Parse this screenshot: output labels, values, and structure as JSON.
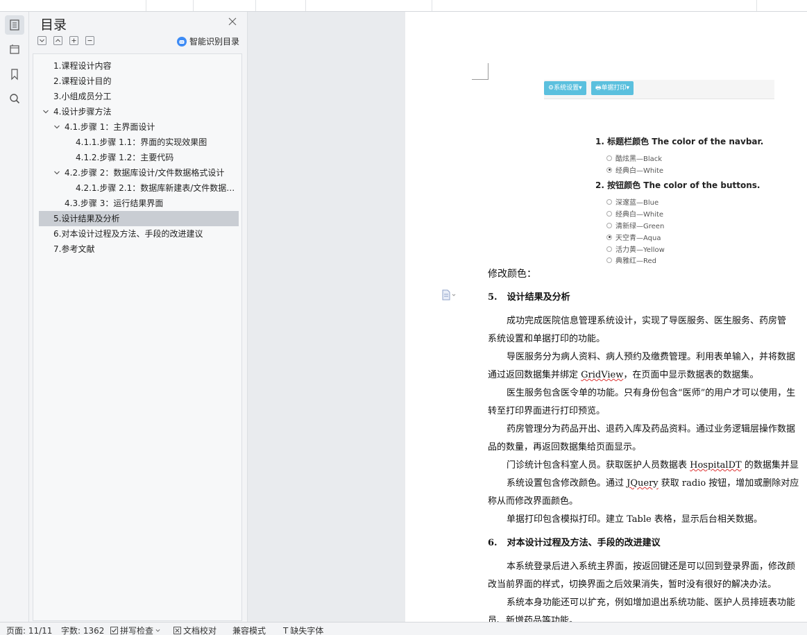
{
  "toc": {
    "title": "目录",
    "smart_label": "智能识别目录",
    "items": [
      {
        "label": "1.课程设计内容",
        "level": 0
      },
      {
        "label": "2.课程设计目的",
        "level": 0
      },
      {
        "label": "3.小组成员分工",
        "level": 0
      },
      {
        "label": "4.设计步骤方法",
        "level": 0,
        "expanded": true
      },
      {
        "label": "4.1.步骤 1：主界面设计",
        "level": 1,
        "expanded": true
      },
      {
        "label": "4.1.1.步骤 1.1：界面的实现效果图",
        "level": 2
      },
      {
        "label": "4.1.2.步骤 1.2：主要代码",
        "level": 2
      },
      {
        "label": "4.2.步骤 2：数据库设计/文件数据格式设计",
        "level": 1,
        "expanded": true
      },
      {
        "label": "4.2.1.步骤 2.1：数据库新建表/文件数据格式",
        "level": 2
      },
      {
        "label": "4.3.步骤 3：运行结果界面",
        "level": 1
      },
      {
        "label": "5.设计结果及分析",
        "level": 0,
        "selected": true
      },
      {
        "label": "6.对本设计过程及方法、手段的改进建议",
        "level": 0
      },
      {
        "label": "7.参考文献",
        "level": 0
      }
    ]
  },
  "document": {
    "embed": {
      "btn_settings": "⚙系统设置▾",
      "btn_print": "🖶单据打印▾",
      "section1": "1. 标题栏颜色 The color of the navbar.",
      "options1": [
        {
          "label": "酷炫黑—Black",
          "checked": false
        },
        {
          "label": "经典白—White",
          "checked": true
        }
      ],
      "section2": "2. 按钮颜色 The color of the buttons.",
      "options2": [
        {
          "label": "深邃蓝—Blue",
          "checked": false
        },
        {
          "label": "经典白—White",
          "checked": false
        },
        {
          "label": "清新绿—Green",
          "checked": false
        },
        {
          "label": "天空青—Aqua",
          "checked": true
        },
        {
          "label": "活力黄—Yellow",
          "checked": false
        },
        {
          "label": "典雅红—Red",
          "checked": false
        }
      ]
    },
    "caption": "修改颜色：",
    "heading5_num": "5.",
    "heading5": "设计结果及分析",
    "p1a": "成功完成医院信息管理系统设计，实现了导医服务、医生服务、药房管",
    "p1b": "系统设置和单据打印的功能。",
    "p2a": "导医服务分为病人资料、病人预约及缴费管理。利用表单输入，并将数据",
    "p2b_pre": "通过返回数据集并绑定 ",
    "p2b_mark": "GridView",
    "p2b_post": "，在页面中显示数据表的数据集。",
    "p3a": "医生服务包含医令单的功能。只有身份包含“医师”的用户才可以使用，生",
    "p3b": "转至打印界面进行打印预览。",
    "p4a": "药房管理分为药品开出、退药入库及药品资料。通过业务逻辑层操作数据",
    "p4b": "品的数量，再返回数据集给页面显示。",
    "p5_pre": "门诊统计包含科室人员。获取医护人员数据表 ",
    "p5_mark": "HospitalDT",
    "p5_post": " 的数据集并显",
    "p6_pre": "系统设置包含修改颜色。通过 ",
    "p6_mark": "JQuery",
    "p6_post": " 获取 radio 按钮，增加或删除对应",
    "p6b": "称从而修改界面颜色。",
    "p7": "单据打印包含模拟打印。建立 Table 表格，显示后台相关数据。",
    "heading6_num": "6.",
    "heading6": "对本设计过程及方法、手段的改进建议",
    "p8a": "本系统登录后进入系统主界面，按返回键还是可以回到登录界面，修改颜",
    "p8b": "改当前界面的样式，切换界面之后效果消失，暂时没有很好的解决办法。",
    "p9a": "系统本身功能还可以扩充，例如增加退出系统功能、医护人员排班表功能",
    "p9b": "员、新增药品等功能。"
  },
  "status": {
    "page": "页面: 11/11",
    "words": "字数: 1362",
    "spell": "拼写检查",
    "proof": "文档校对",
    "compat": "兼容模式",
    "missing_font": "缺失字体"
  },
  "colors": {
    "accent": "#5bc0de",
    "selected_row": "#c9cdd3",
    "smart_icon": "#3d8bf5"
  }
}
